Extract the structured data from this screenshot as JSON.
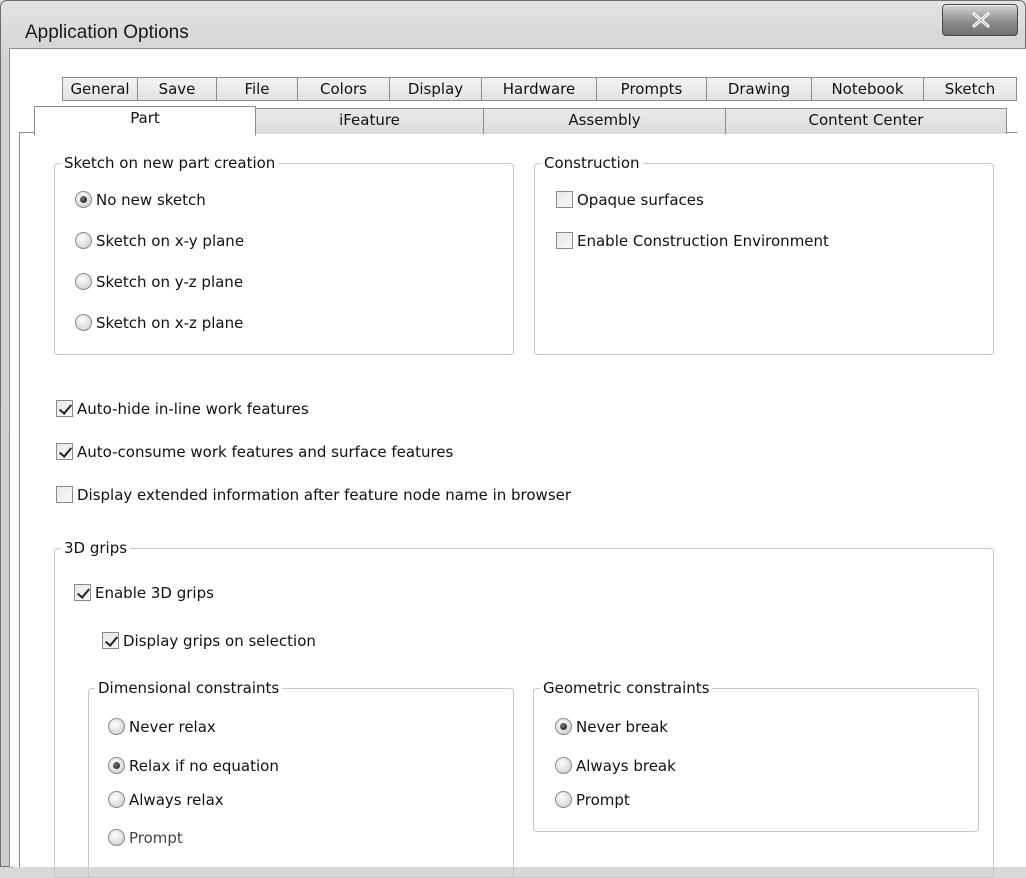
{
  "window": {
    "title": "Application Options",
    "close_glyph": "X"
  },
  "tabs_row1": [
    "General",
    "Save",
    "File",
    "Colors",
    "Display",
    "Hardware",
    "Prompts",
    "Drawing",
    "Notebook",
    "Sketch"
  ],
  "tabs_row2": [
    "Part",
    "iFeature",
    "Assembly",
    "Content Center"
  ],
  "active_tab": "Part",
  "sketch_group": {
    "legend": "Sketch on new part creation",
    "options": [
      {
        "label": "No new sketch",
        "checked": true
      },
      {
        "label": "Sketch on x-y plane",
        "checked": false
      },
      {
        "label": "Sketch on y-z plane",
        "checked": false
      },
      {
        "label": "Sketch on x-z plane",
        "checked": false
      }
    ]
  },
  "construction_group": {
    "legend": "Construction",
    "options": [
      {
        "label": "Opaque surfaces",
        "checked": false
      },
      {
        "label": "Enable Construction Environment",
        "checked": false
      }
    ]
  },
  "features": [
    {
      "label": "Auto-hide in-line work features",
      "checked": true
    },
    {
      "label": "Auto-consume work features and surface features",
      "checked": true
    },
    {
      "label": "Display extended information after feature node name in browser",
      "checked": false
    }
  ],
  "grips_group": {
    "legend": "3D grips",
    "enable_label": "Enable 3D grips",
    "enable_checked": true,
    "display_label": "Display grips on selection",
    "display_checked": true,
    "dimensional": {
      "legend": "Dimensional constraints",
      "options": [
        {
          "label": "Never relax",
          "checked": false
        },
        {
          "label": "Relax if no equation",
          "checked": true
        },
        {
          "label": "Always relax",
          "checked": false
        },
        {
          "label": "Prompt",
          "checked": false
        }
      ]
    },
    "geometric": {
      "legend": "Geometric constraints",
      "options": [
        {
          "label": "Never break",
          "checked": true
        },
        {
          "label": "Always break",
          "checked": false
        },
        {
          "label": "Prompt",
          "checked": false
        }
      ]
    }
  }
}
